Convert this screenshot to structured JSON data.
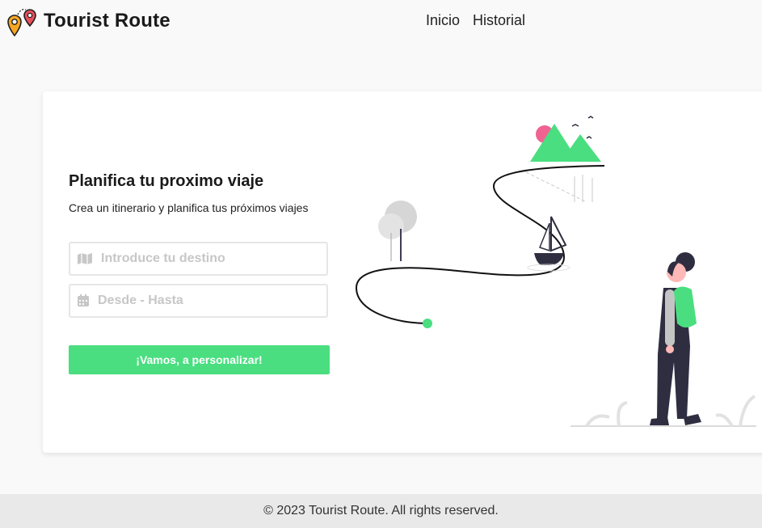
{
  "header": {
    "brand": "Tourist Route",
    "nav": [
      "Inicio",
      "Historial"
    ]
  },
  "form": {
    "title": "Planifica tu proximo viaje",
    "subtitle": "Crea un itinerario y planifica tus próximos viajes",
    "destination_placeholder": "Introduce tu destino",
    "dates_placeholder": "Desde - Hasta",
    "submit_label": "¡Vamos, a personalizar!"
  },
  "icons": {
    "logo": "map-pins-logo-icon",
    "destination": "map-icon",
    "dates": "calendar-icon"
  },
  "colors": {
    "accent": "#4ade80",
    "pin_orange": "#f5a623",
    "pin_red": "#e8505b",
    "sun": "#f06292",
    "dark": "#2f2e41"
  },
  "footer": {
    "text": "© 2023 Tourist Route. All rights reserved."
  }
}
